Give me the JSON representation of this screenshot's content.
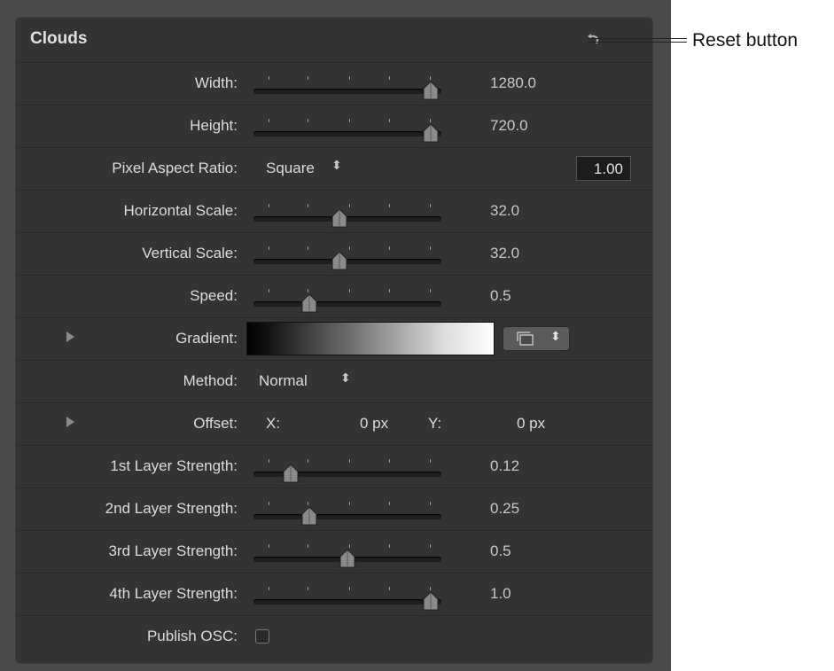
{
  "panel": {
    "title": "Clouds",
    "reset_icon": "reset-arrow-icon"
  },
  "callout": {
    "text": "Reset button"
  },
  "rows": {
    "width": {
      "label": "Width:",
      "value": "1280.0",
      "slider_fraction": 1.0
    },
    "height": {
      "label": "Height:",
      "value": "720.0",
      "slider_fraction": 1.0
    },
    "pixel_aspect": {
      "label": "Pixel Aspect Ratio:",
      "popup": "Square",
      "number": "1.00"
    },
    "horizontal_scale": {
      "label": "Horizontal Scale:",
      "value": "32.0",
      "slider_fraction": 0.45
    },
    "vertical_scale": {
      "label": "Vertical Scale:",
      "value": "32.0",
      "slider_fraction": 0.45
    },
    "speed": {
      "label": "Speed:",
      "value": "0.5",
      "slider_fraction": 0.27
    },
    "gradient": {
      "label": "Gradient:"
    },
    "method": {
      "label": "Method:",
      "popup": "Normal"
    },
    "offset": {
      "label": "Offset:",
      "x_label": "X:",
      "x_value": "0 px",
      "y_label": "Y:",
      "y_value": "0 px"
    },
    "layer1": {
      "label": "1st Layer Strength:",
      "value": "0.12",
      "slider_fraction": 0.16
    },
    "layer2": {
      "label": "2nd Layer Strength:",
      "value": "0.25",
      "slider_fraction": 0.27
    },
    "layer3": {
      "label": "3rd Layer Strength:",
      "value": "0.5",
      "slider_fraction": 0.5
    },
    "layer4": {
      "label": "4th Layer Strength:",
      "value": "1.0",
      "slider_fraction": 1.0
    },
    "publish_osc": {
      "label": "Publish OSC:",
      "checked": false
    }
  },
  "colors": {
    "panel_bg": "#333333",
    "outer_bg": "#4a4a4a",
    "text": "#dcdcdc"
  }
}
